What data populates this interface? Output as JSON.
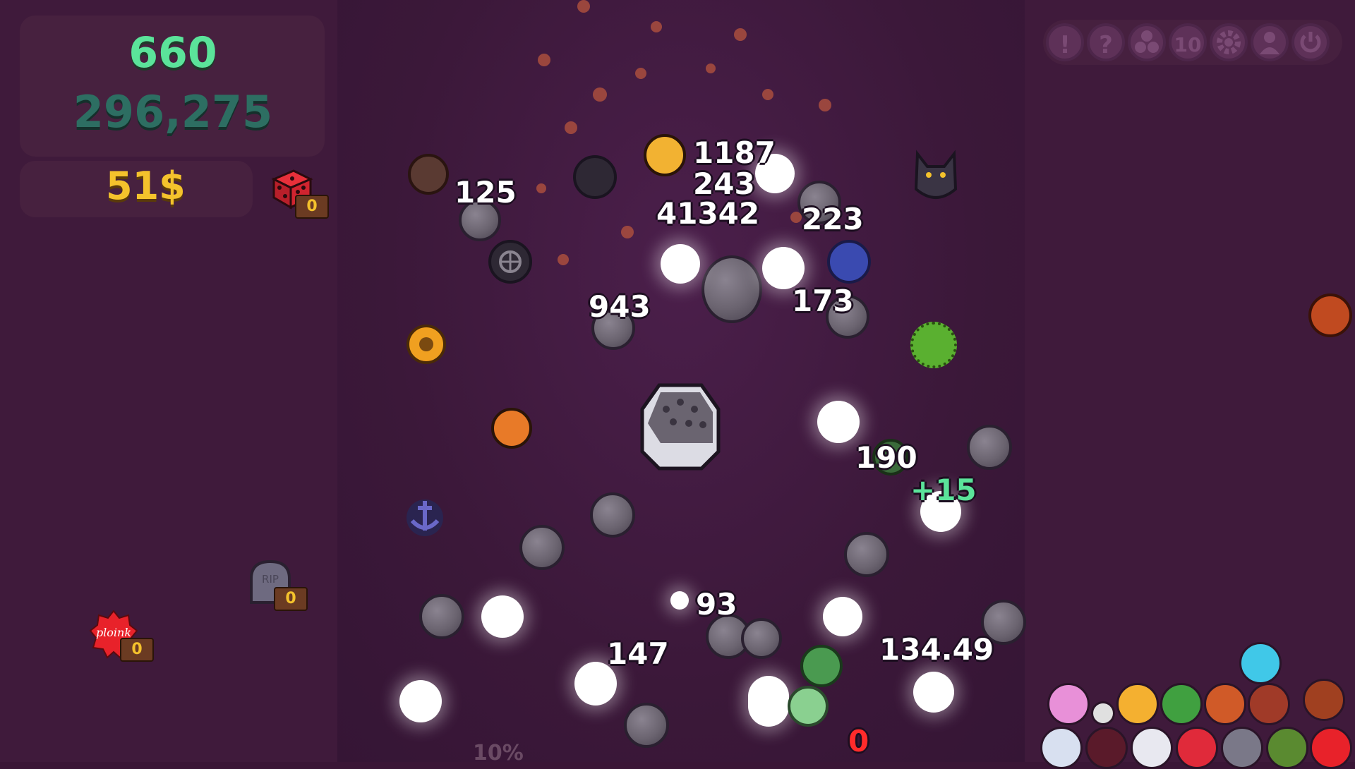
{
  "scores": {
    "current": "660",
    "total": "296,275"
  },
  "money": "51$",
  "item_counts": {
    "dice": "0",
    "grave": "0",
    "ploink": "0"
  },
  "ploink_label": "ploink",
  "grave_label": "RIP",
  "percent_text": "10%",
  "hud_buttons": [
    {
      "label": "!",
      "icon": "alert-icon"
    },
    {
      "label": "?",
      "icon": "help-icon"
    },
    {
      "label": "",
      "icon": "balls-icon"
    },
    {
      "label": "10",
      "icon": "speed-10-icon"
    },
    {
      "label": "",
      "icon": "gear-icon"
    },
    {
      "label": "",
      "icon": "profile-icon"
    },
    {
      "label": "",
      "icon": "power-icon"
    }
  ],
  "floating_numbers": [
    "1187",
    "243",
    "41342",
    "223",
    "125",
    "943",
    "173",
    "190",
    "+15",
    "93",
    "147",
    "134.49",
    "0"
  ],
  "colors": {
    "score": "#5be39a",
    "total": "#2d6e62",
    "money": "#f4c22c",
    "background": "#3a1636"
  }
}
